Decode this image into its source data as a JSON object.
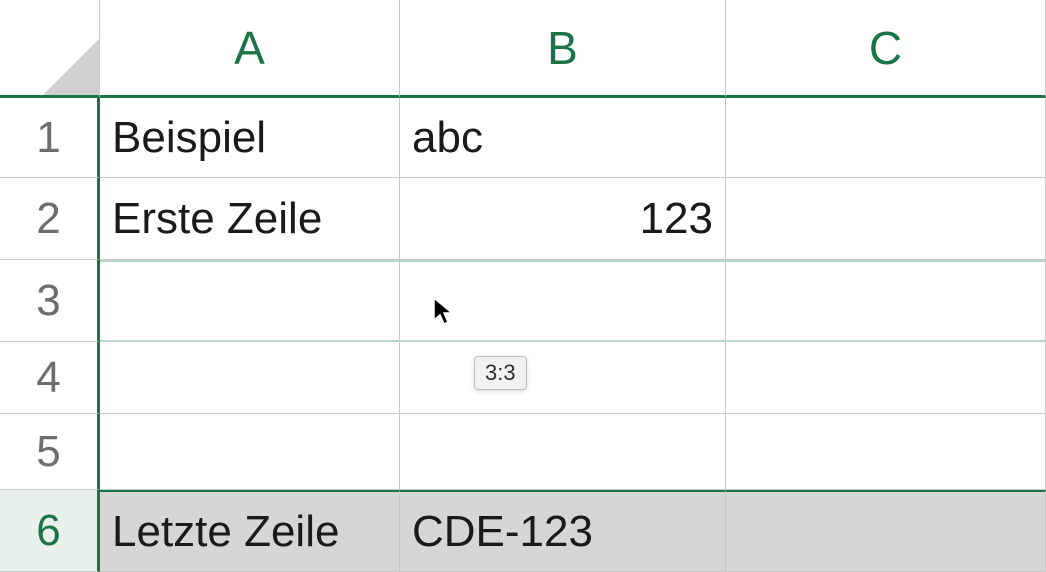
{
  "columns": [
    "A",
    "B",
    "C"
  ],
  "rows": [
    "1",
    "2",
    "3",
    "4",
    "5",
    "6"
  ],
  "cells": {
    "A1": "Beispiel",
    "B1": "abc",
    "A2": "Erste Zeile",
    "B2": "123",
    "A6": "Letzte Zeile",
    "B6": "CDE-123"
  },
  "tooltip": "3:3",
  "selectedRow": 6,
  "highlightRow": 3
}
